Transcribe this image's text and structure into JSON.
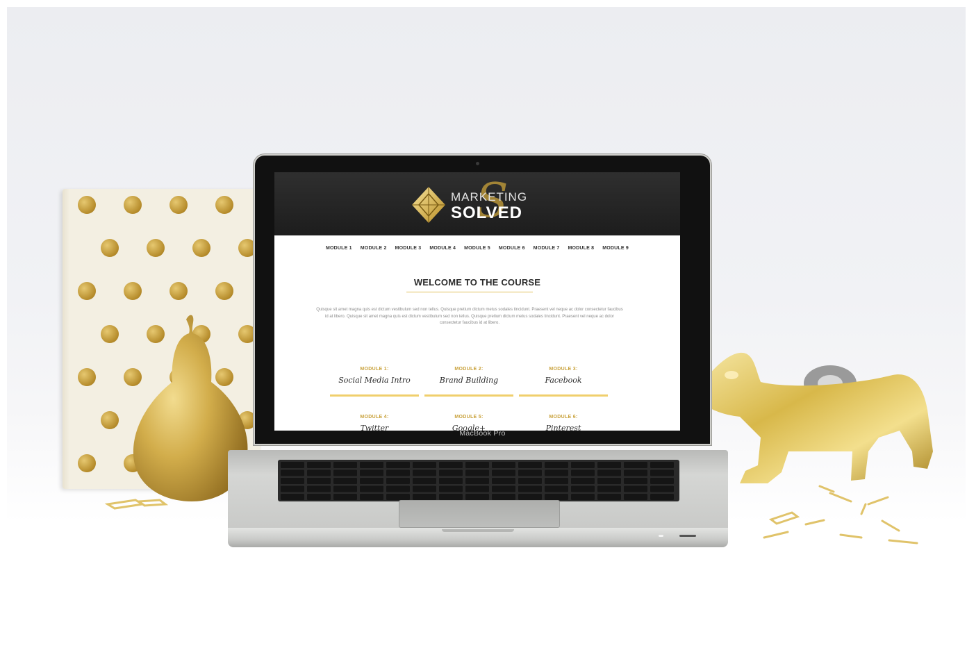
{
  "device": {
    "brand_label": "MacBook Pro"
  },
  "site": {
    "logo": {
      "word_top": "MARKETING",
      "word_bottom": "SOLVED",
      "swash_letter": "S"
    },
    "nav": [
      "MODULE 1",
      "MODULE 2",
      "MODULE 3",
      "MODULE 4",
      "MODULE 5",
      "MODULE 6",
      "MODULE 7",
      "MODULE 8",
      "MODULE 9"
    ],
    "welcome_title": "WELCOME TO THE COURSE",
    "intro_text": "Quisque sit amet magna quis est dictum vestibulum sed non tellus. Quisque pretium dictum metus sodales tincidunt. Praesent vel neque ac dolor consectetur faucibus id at libero. Quisque sit amet magna quis est dictum vestibulum sed non tellus. Quisque pretium dictum metus sodales tincidunt. Praesent vel neque ac dolor consectetur faucibus id at libero.",
    "modules": [
      {
        "label": "MODULE 1:",
        "title": "Social Media Intro"
      },
      {
        "label": "MODULE 2:",
        "title": "Brand Building"
      },
      {
        "label": "MODULE 3:",
        "title": "Facebook"
      },
      {
        "label": "MODULE 4:",
        "title": "Twitter"
      },
      {
        "label": "MODULE 5:",
        "title": "Google+"
      },
      {
        "label": "MODULE 6:",
        "title": "Pinterest"
      }
    ]
  },
  "colors": {
    "accent_gold": "#e2c15a",
    "header_dark": "#262626",
    "module_bar": "#f0cf6c"
  }
}
